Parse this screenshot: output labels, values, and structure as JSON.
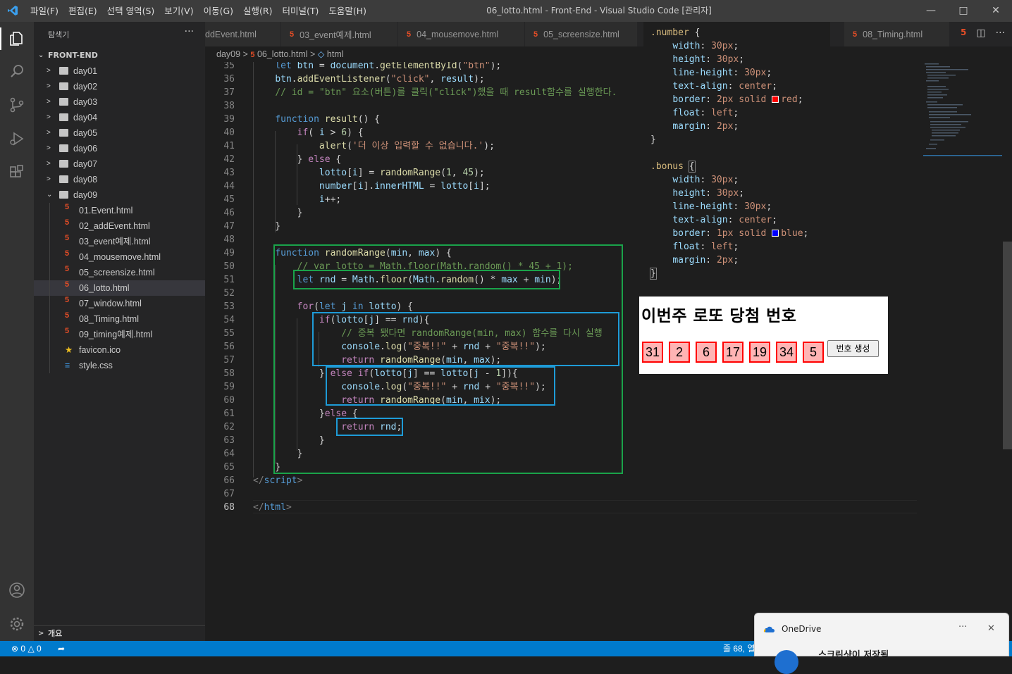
{
  "window": {
    "title": "06_lotto.html - Front-End - Visual Studio Code [관리자]"
  },
  "menu": [
    "파일(F)",
    "편집(E)",
    "선택 영역(S)",
    "보기(V)",
    "이동(G)",
    "실행(R)",
    "터미널(T)",
    "도움말(H)"
  ],
  "sidebar": {
    "title": "탐색기",
    "folder": "FRONT-END",
    "folders": [
      "day01",
      "day02",
      "day03",
      "day04",
      "day05",
      "day06",
      "day07",
      "day08",
      "day09"
    ],
    "files": [
      "01.Event.html",
      "02_addEvent.html",
      "03_event예제.html",
      "04_mousemove.html",
      "05_screensize.html",
      "06_lotto.html",
      "07_window.html",
      "08_Timing.html",
      "09_timing예제.html",
      "favicon.ico",
      "style.css"
    ],
    "outline": "개요"
  },
  "tabs": [
    "ddEvent.html",
    "03_event예제.html",
    "04_mousemove.html",
    "05_screensize.html",
    "08_Timing.html"
  ],
  "breadcrumb": {
    "folder": "day09",
    "file": "06_lotto.html",
    "symbol": "html"
  },
  "editor": {
    "line_numbers": [
      "35",
      "36",
      "37",
      "38",
      "39",
      "40",
      "41",
      "42",
      "43",
      "44",
      "45",
      "46",
      "47",
      "48",
      "49",
      "50",
      "51",
      "52",
      "53",
      "54",
      "55",
      "56",
      "57",
      "58",
      "59",
      "60",
      "61",
      "62",
      "63",
      "64",
      "65",
      "66",
      "67",
      "68"
    ]
  },
  "preview": {
    "title": "이번주 로또 당첨 번호",
    "numbers": [
      "31",
      "2",
      "6",
      "17",
      "19",
      "34"
    ],
    "bonus": "5",
    "button": "번호 생성"
  },
  "status": {
    "errors": "0",
    "warnings": "0",
    "position": "줄 68, 열"
  },
  "notification": {
    "app": "OneDrive",
    "message": "스크린샷이 저장됨",
    "more": "···",
    "close": "✕"
  },
  "colors": {
    "accent": "#007acc",
    "green_box": "#1aa34a",
    "blue_box": "#1e9bd7"
  }
}
